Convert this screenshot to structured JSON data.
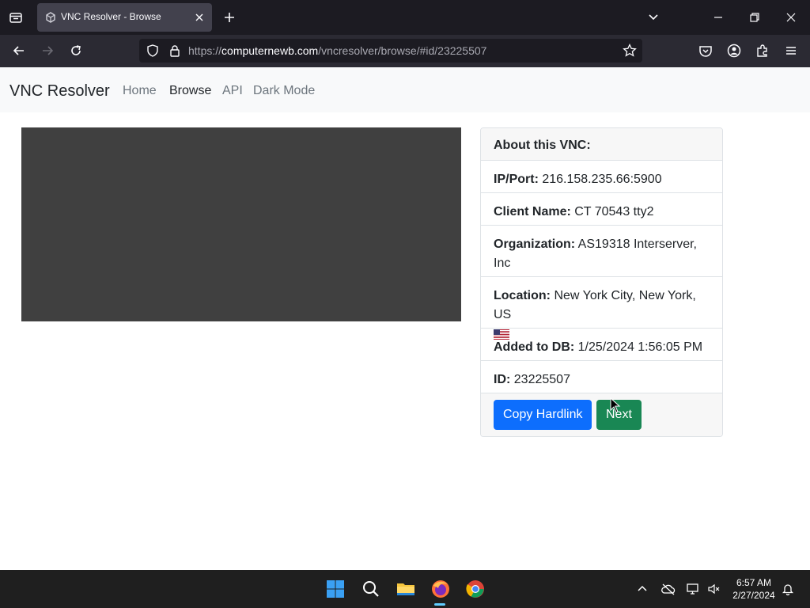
{
  "browser": {
    "tab_title": "VNC Resolver - Browse",
    "url_prefix": "https://",
    "url_host": "computernewb.com",
    "url_path": "/vncresolver/browse/#id/23225507"
  },
  "site": {
    "brand": "VNC Resolver",
    "nav": [
      "Home",
      "Browse",
      "API",
      "Dark Mode"
    ],
    "active_nav": "Browse"
  },
  "card": {
    "header": "About this VNC:",
    "ip_label": "IP/Port:",
    "ip_value": "216.158.235.66:5900",
    "client_label": "Client Name:",
    "client_value": "CT 70543 tty2",
    "org_label": "Organization:",
    "org_value": "AS19318 Interserver, Inc",
    "location_label": "Location:",
    "location_value": "New York City, New York, US",
    "added_label": "Added to DB:",
    "added_value": "1/25/2024 1:56:05 PM",
    "id_label": "ID:",
    "id_value": "23225507",
    "copy_button": "Copy Hardlink",
    "next_button": "Next"
  },
  "taskbar": {
    "time": "6:57 AM",
    "date": "2/27/2024"
  },
  "colors": {
    "primary": "#0d6efd",
    "success": "#198754",
    "screen": "#404040"
  }
}
